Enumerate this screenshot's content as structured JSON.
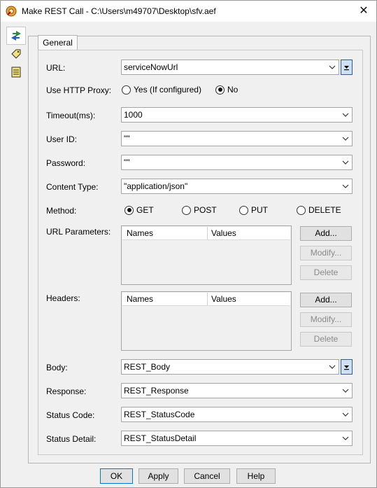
{
  "window": {
    "title": "Make REST Call - C:\\Users\\m49707\\Desktop\\sfv.aef",
    "close_glyph": "✕"
  },
  "tabs": [
    {
      "label": "General"
    }
  ],
  "form": {
    "url": {
      "label": "URL:",
      "value": "serviceNowUrl"
    },
    "proxy": {
      "label": "Use HTTP Proxy:",
      "yes_label": "Yes (If configured)",
      "no_label": "No",
      "selected": "No"
    },
    "timeout": {
      "label": "Timeout(ms):",
      "value": "1000"
    },
    "user_id": {
      "label": "User ID:",
      "value": "\"\""
    },
    "password": {
      "label": "Password:",
      "value": "\"\""
    },
    "content_type": {
      "label": "Content Type:",
      "value": "\"application/json\""
    },
    "method": {
      "label": "Method:",
      "options": [
        "GET",
        "POST",
        "PUT",
        "DELETE"
      ],
      "selected": "GET"
    },
    "url_params": {
      "label": "URL Parameters:",
      "col_names": "Names",
      "col_values": "Values",
      "add": "Add...",
      "modify": "Modify...",
      "delete": "Delete"
    },
    "headers": {
      "label": "Headers:",
      "col_names": "Names",
      "col_values": "Values",
      "add": "Add...",
      "modify": "Modify...",
      "delete": "Delete"
    },
    "body": {
      "label": "Body:",
      "value": "REST_Body"
    },
    "response": {
      "label": "Response:",
      "value": "REST_Response"
    },
    "status_code": {
      "label": "Status Code:",
      "value": "REST_StatusCode"
    },
    "status_detail": {
      "label": "Status Detail:",
      "value": "REST_StatusDetail"
    }
  },
  "footer": {
    "ok": "OK",
    "apply": "Apply",
    "cancel": "Cancel",
    "help": "Help"
  }
}
